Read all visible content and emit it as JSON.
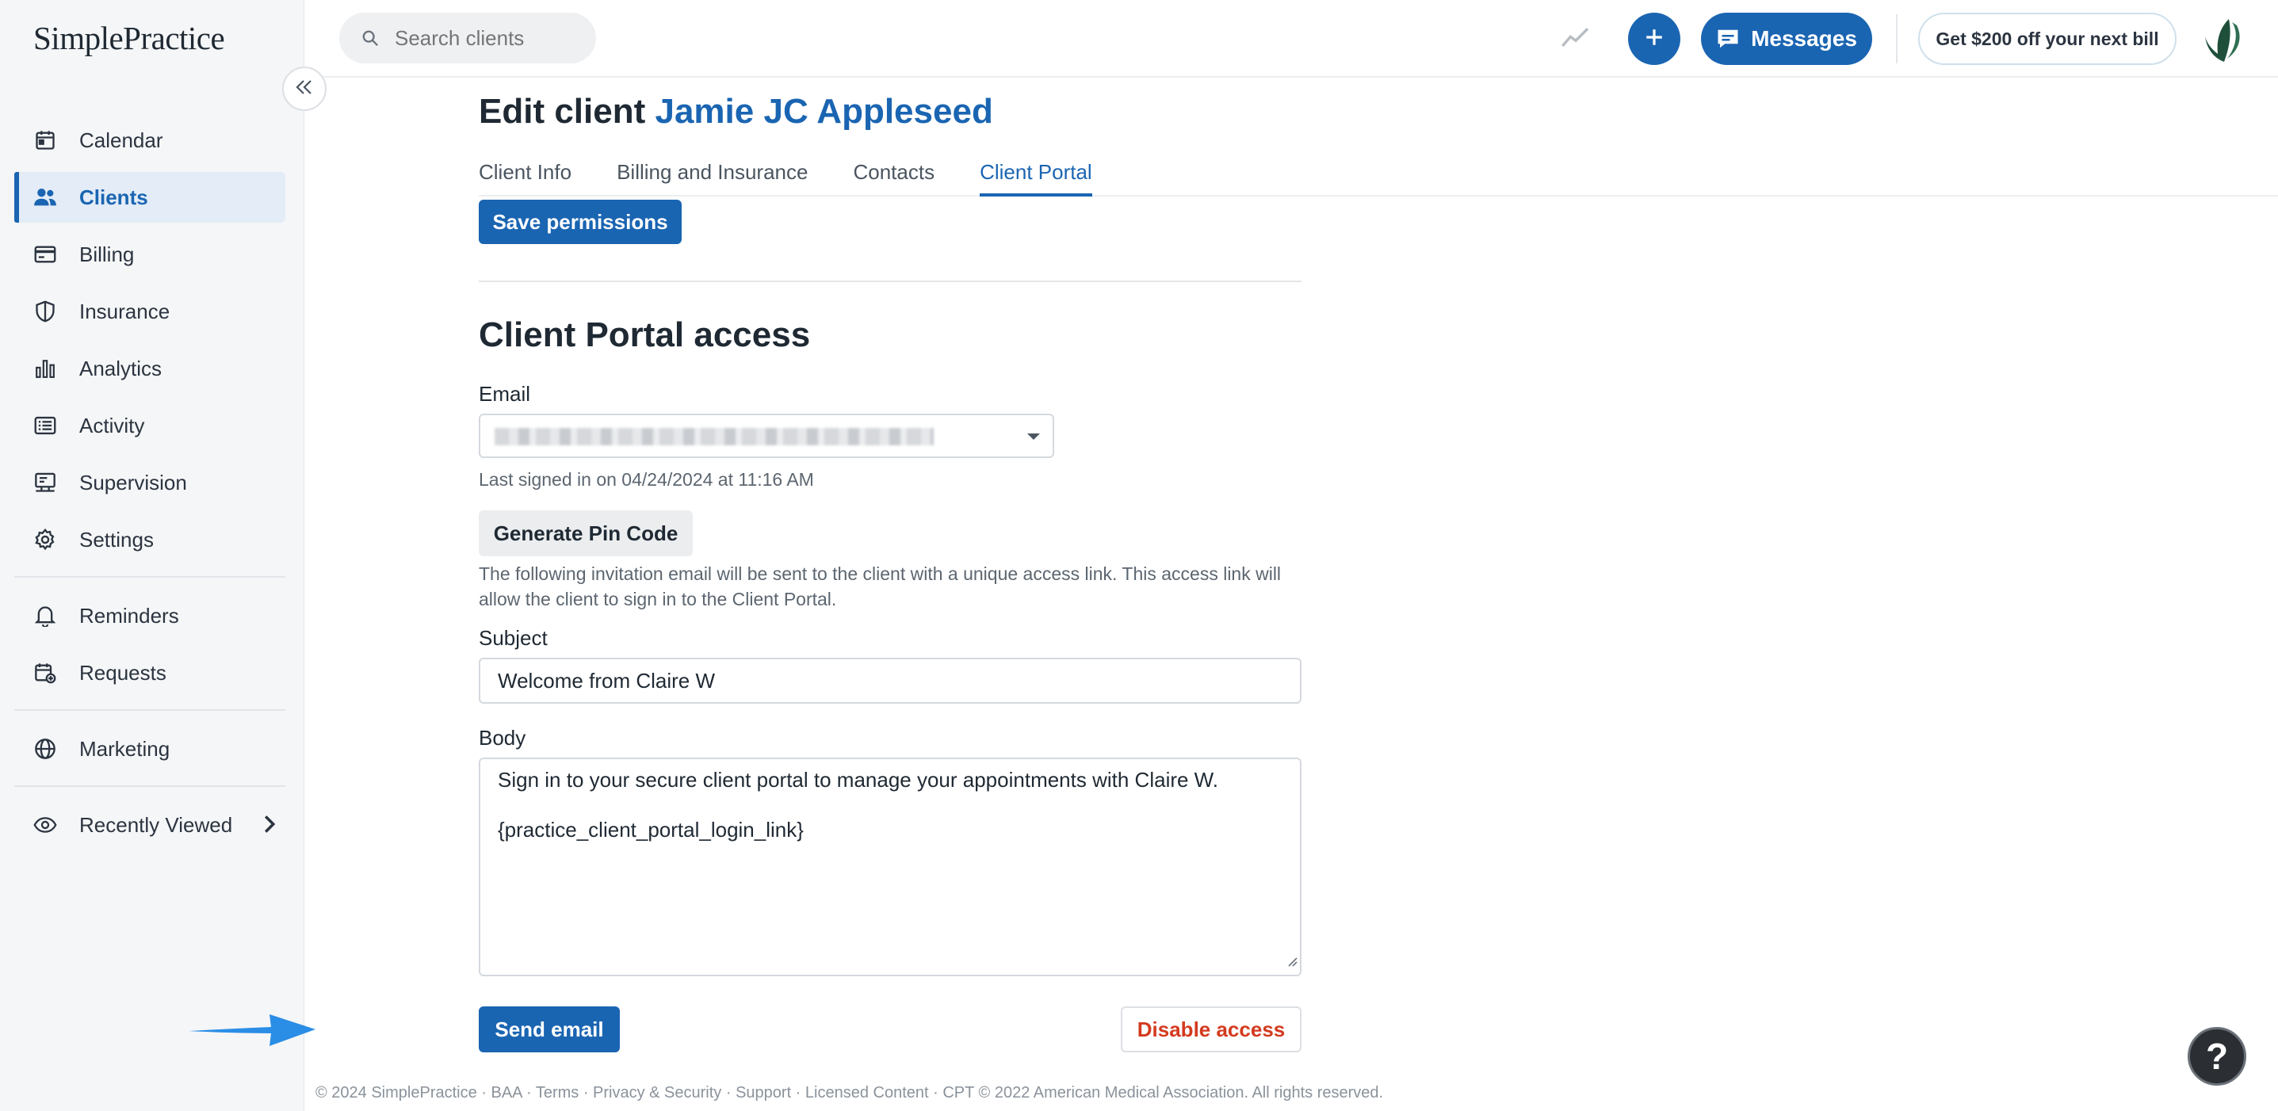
{
  "brand": {
    "logo_text": "SimplePractice",
    "accent": "#1a65b2",
    "danger": "#d43a1f"
  },
  "sidebar": {
    "items": [
      {
        "label": "Calendar",
        "icon": "calendar-icon"
      },
      {
        "label": "Clients",
        "icon": "clients-icon",
        "active": true
      },
      {
        "label": "Billing",
        "icon": "billing-icon"
      },
      {
        "label": "Insurance",
        "icon": "shield-icon"
      },
      {
        "label": "Analytics",
        "icon": "bar-chart-icon"
      },
      {
        "label": "Activity",
        "icon": "list-icon"
      },
      {
        "label": "Supervision",
        "icon": "supervision-icon"
      },
      {
        "label": "Settings",
        "icon": "gear-icon"
      }
    ],
    "secondary": [
      {
        "label": "Reminders",
        "icon": "bell-icon"
      },
      {
        "label": "Requests",
        "icon": "calendar-add-icon"
      }
    ],
    "marketing": {
      "label": "Marketing",
      "icon": "globe-icon"
    },
    "recent": {
      "label": "Recently Viewed",
      "icon": "eye-icon"
    }
  },
  "topbar": {
    "search_placeholder": "Search clients",
    "messages_label": "Messages",
    "promo_label": "Get $200 off your next bill"
  },
  "page": {
    "title_prefix": "Edit client",
    "client_name": "Jamie JC Appleseed",
    "tabs": [
      {
        "label": "Client Info"
      },
      {
        "label": "Billing and Insurance"
      },
      {
        "label": "Contacts"
      },
      {
        "label": "Client Portal",
        "active": true
      }
    ],
    "save_permissions_label": "Save permissions",
    "section_title": "Client Portal access",
    "email_label": "Email",
    "last_signed_in": "Last signed in on 04/24/2024 at 11:16 AM",
    "generate_pin_label": "Generate Pin Code",
    "invitation_note": "The following invitation email will be sent to the client with a unique access link. This access link will allow the client to sign in to the Client Portal.",
    "subject_label": "Subject",
    "subject_value": "Welcome from Claire W",
    "body_label": "Body",
    "body_line1": "Sign in to your secure client portal to manage your appointments with Claire W.",
    "body_line2": "{practice_client_portal_login_link}",
    "send_email_label": "Send email",
    "disable_access_label": "Disable access"
  },
  "footer": {
    "text": "© 2024 SimplePractice · BAA · Terms · Privacy & Security · Support · Licensed Content · CPT © 2022 American Medical Association. All rights reserved."
  },
  "help": {
    "label": "?"
  }
}
